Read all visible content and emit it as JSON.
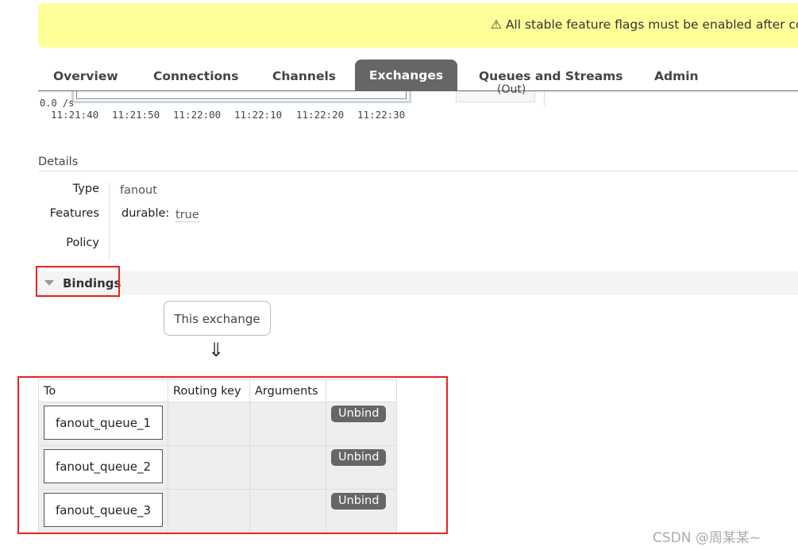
{
  "banner": {
    "icon": "warning-icon",
    "text": "⚠ All stable feature flags must be enabled after co"
  },
  "nav": {
    "tabs": [
      {
        "label": "Overview"
      },
      {
        "label": "Connections"
      },
      {
        "label": "Channels"
      },
      {
        "label": "Exchanges",
        "active": true
      },
      {
        "label": "Queues and Streams"
      },
      {
        "label": "Admin"
      }
    ]
  },
  "chart": {
    "y_label": "0.0 /s",
    "x_ticks": [
      "11:21:40",
      "11:21:50",
      "11:22:00",
      "11:22:10",
      "11:22:20",
      "11:22:30"
    ],
    "legend_label": "(Out)"
  },
  "details": {
    "title": "Details",
    "type_label": "Type",
    "type_value": "fanout",
    "features_label": "Features",
    "features_key": "durable:",
    "features_value": "true",
    "policy_label": "Policy"
  },
  "bindings": {
    "title": "Bindings",
    "source_label": "This exchange",
    "arrow": "⇓",
    "columns": [
      "To",
      "Routing key",
      "Arguments",
      ""
    ],
    "rows": [
      {
        "to": "fanout_queue_1",
        "routing_key": "",
        "arguments": "",
        "action": "Unbind"
      },
      {
        "to": "fanout_queue_2",
        "routing_key": "",
        "arguments": "",
        "action": "Unbind"
      },
      {
        "to": "fanout_queue_3",
        "routing_key": "",
        "arguments": "",
        "action": "Unbind"
      }
    ]
  },
  "watermark": "CSDN @周某某~",
  "colors": {
    "banner": "#ffff99",
    "active_tab": "#666666",
    "highlight": "#e8221f"
  }
}
